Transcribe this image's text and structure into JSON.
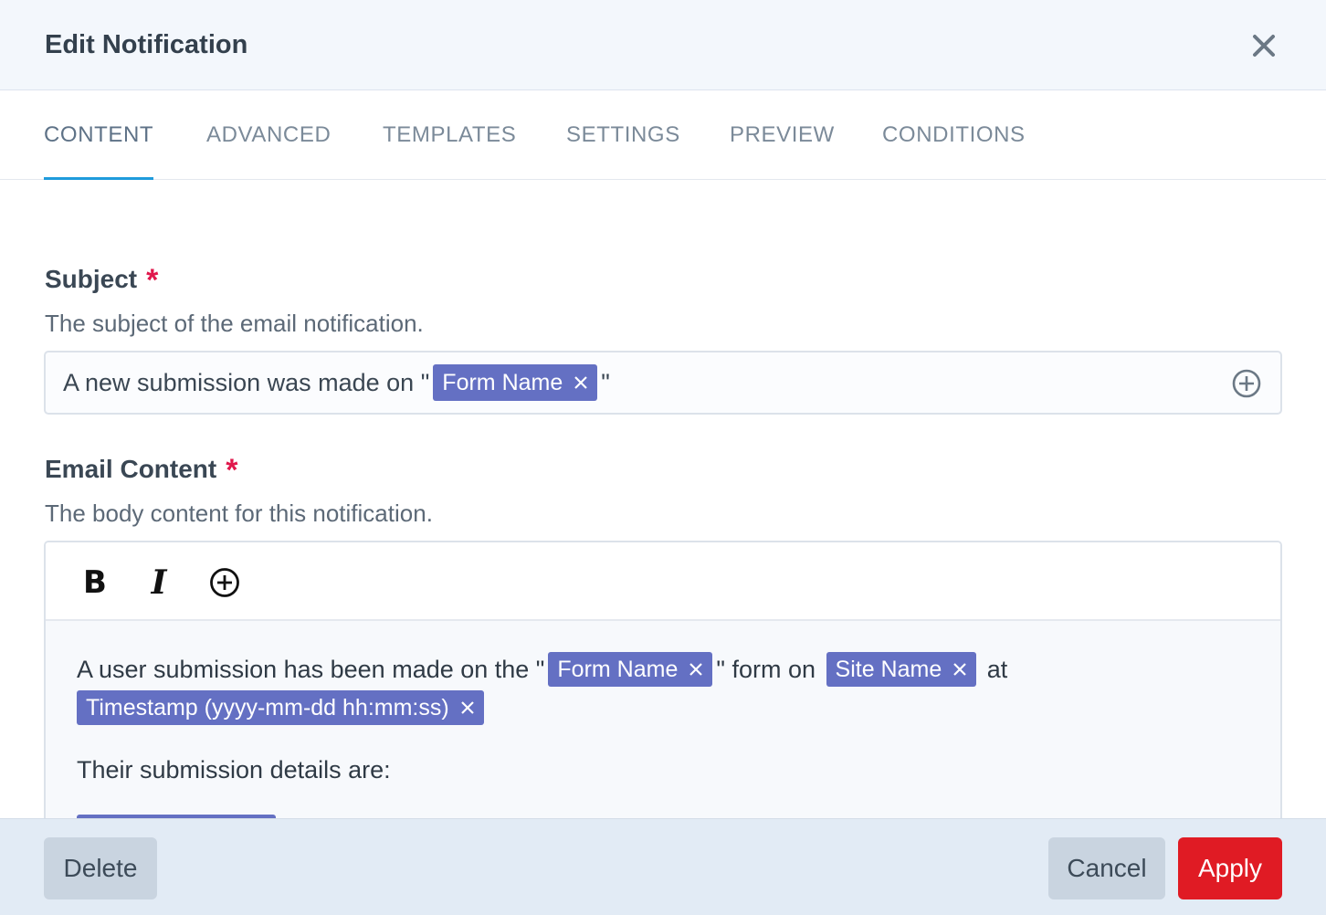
{
  "dialog": {
    "title": "Edit Notification"
  },
  "tabs": [
    {
      "label": "CONTENT",
      "active": true
    },
    {
      "label": "ADVANCED",
      "active": false
    },
    {
      "label": "TEMPLATES",
      "active": false
    },
    {
      "label": "SETTINGS",
      "active": false
    },
    {
      "label": "PREVIEW",
      "active": false
    },
    {
      "label": "CONDITIONS",
      "active": false
    }
  ],
  "subject": {
    "label": "Subject",
    "required_mark": "*",
    "help": "The subject of the email notification.",
    "text_before": "A new submission was made on \"",
    "token": "Form Name",
    "text_after": "\""
  },
  "email_content": {
    "label": "Email Content",
    "required_mark": "*",
    "help": "The body content for this notification.",
    "toolbar": {
      "bold_label": "B",
      "italic_label": "I"
    },
    "body": {
      "line1_text1": "A user submission has been made on the \"",
      "token_form_name": "Form Name",
      "line1_text2": "\" form on",
      "token_site_name": "Site Name",
      "line1_text3": "at",
      "token_timestamp": "Timestamp (yyyy-mm-dd hh:mm:ss)",
      "paragraph2": "Their submission details are:"
    }
  },
  "footer": {
    "delete_label": "Delete",
    "cancel_label": "Cancel",
    "apply_label": "Apply"
  },
  "colors": {
    "accent_tab": "#1f9bdc",
    "token_bg": "#6470c3",
    "required": "#e0184c",
    "apply_bg": "#e01b24"
  },
  "icons": {
    "close": "close-icon",
    "add_token": "plus-circle-icon",
    "remove_token": "x-icon"
  }
}
